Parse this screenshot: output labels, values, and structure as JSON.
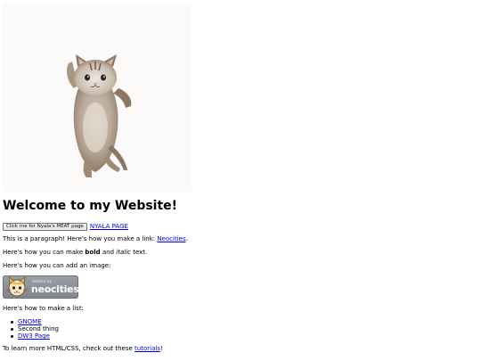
{
  "header": {
    "title": "Welcome to my Website!"
  },
  "image": {
    "icon": "dancing-cat"
  },
  "button": {
    "label": "Click me for Nyala's MEAT page"
  },
  "nyala_link": {
    "label": "NYALA PAGE"
  },
  "paragraph": {
    "prefix": "This is a paragraph! Here's how you make a link: ",
    "link": "Neocities",
    "suffix": "."
  },
  "formatting": {
    "prefix": "Here's how you can make ",
    "bold": "bold",
    "middle": " and ",
    "italic": "italic",
    "suffix": " text."
  },
  "image_intro": "Here's how you can add an image:",
  "badge": {
    "small_text": "hosted by",
    "word": "neocities"
  },
  "list_intro": "Here's how to make a list:",
  "list": {
    "items": [
      {
        "label": "GNOME",
        "link": true
      },
      {
        "label": "Second thing",
        "link": false
      },
      {
        "label": "DW3 Page",
        "link": true
      }
    ]
  },
  "learn": {
    "prefix": "To learn more HTML/CSS, check out these ",
    "link": "tutorials",
    "suffix": "!"
  },
  "colors": {
    "link": "#0000ee",
    "text": "#000000",
    "badge": "#8c9298"
  }
}
